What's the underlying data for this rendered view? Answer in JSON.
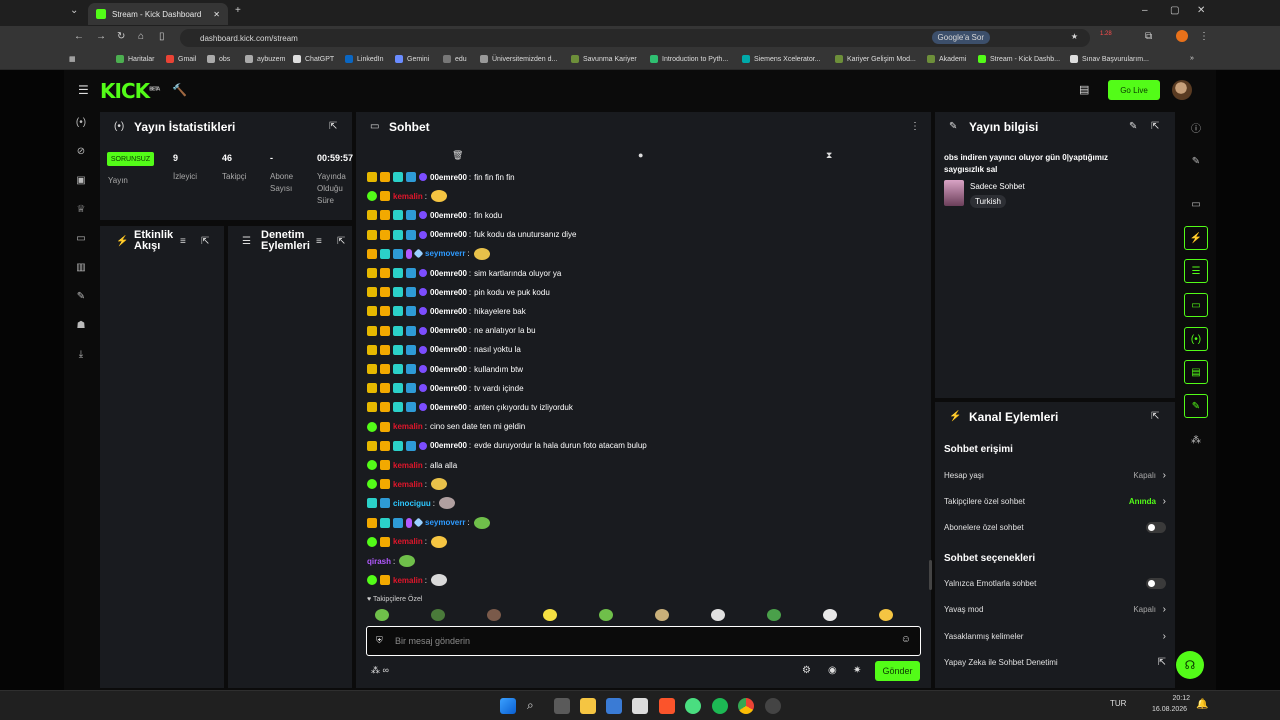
{
  "browser": {
    "tab_title": "Stream - Kick Dashboard",
    "url": "dashboard.kick.com/stream",
    "google_btn": "Google'a Sor",
    "ext_badge": "1.28",
    "bookmarks": [
      "Haritalar",
      "Gmail",
      "obs",
      "aybuzem",
      "ChatGPT",
      "LinkedIn",
      "Gemini",
      "edu",
      "Üniversitemizden d...",
      "Savunma Kariyer",
      "Introduction to Pyth...",
      "Siemens Xcelerator...",
      "Kariyer Gelişim Mod...",
      "Akademi",
      "Stream - Kick Dashb...",
      "Sınav Başvurularım..."
    ]
  },
  "header": {
    "logo": "KICK",
    "logo_sub": "BETA",
    "golive": "Go Live"
  },
  "stats": {
    "title": "Yayın İstatistikleri",
    "status_badge": "SORUNSUZ",
    "status_label": "Yayın",
    "viewers": "9",
    "viewers_label": "İzleyici",
    "followers": "46",
    "followers_label": "Takipçi",
    "subs": "-",
    "subs_label": "Abone Sayısı",
    "uptime": "00:59:57",
    "uptime_label": "Yayında Olduğu Süre"
  },
  "activity": {
    "title": "Etkinlik Akışı"
  },
  "moderation": {
    "title": "Denetim Eylemleri"
  },
  "chat": {
    "title": "Sohbet",
    "followers_only_note": "Takipçilere Özel",
    "input_placeholder": "Bir mesaj gönderin",
    "send": "Gönder",
    "messages": [
      {
        "user": "00emre00",
        "text": "fin fin fin fin"
      },
      {
        "user": "kemalin",
        "text": ""
      },
      {
        "user": "00emre00",
        "text": "fin kodu"
      },
      {
        "user": "00emre00",
        "text": "fuk kodu da unutursanız diye"
      },
      {
        "user": "seymoverr",
        "text": ""
      },
      {
        "user": "00emre00",
        "text": "sim kartlarında oluyor ya"
      },
      {
        "user": "00emre00",
        "text": "pin kodu ve puk kodu"
      },
      {
        "user": "00emre00",
        "text": "hikayelere bak"
      },
      {
        "user": "00emre00",
        "text": "ne anlatıyor la bu"
      },
      {
        "user": "00emre00",
        "text": "nasıl yoktu la"
      },
      {
        "user": "00emre00",
        "text": "kullandım btw"
      },
      {
        "user": "00emre00",
        "text": "tv vardı içinde"
      },
      {
        "user": "00emre00",
        "text": "anten çıkıyordu tv izliyorduk"
      },
      {
        "user": "kemalin",
        "text": "cino sen date ten mi geldin"
      },
      {
        "user": "00emre00",
        "text": "evde duruyordur la hala durun foto atacam bulup"
      },
      {
        "user": "kemalin",
        "text": "alla alla"
      },
      {
        "user": "kemalin",
        "text": ""
      },
      {
        "user": "cinociguu",
        "text": ""
      },
      {
        "user": "seymoverr",
        "text": ""
      },
      {
        "user": "kemalin",
        "text": ""
      },
      {
        "user": "qirash",
        "text": ""
      },
      {
        "user": "kemalin",
        "text": ""
      }
    ],
    "colors": {
      "00emre00": "#ffffff",
      "kemalin": "#e0162b",
      "seymoverr": "#2e9bff",
      "cinociguu": "#2ec8ff",
      "qirash": "#b259ff"
    }
  },
  "streaminfo": {
    "title": "Yayın bilgisi",
    "stream_title": "obs indiren yayıncı oluyor gün 0|yaptığımız saygısızlık sal",
    "category": "Sadece Sohbet",
    "language": "Turkish"
  },
  "channel": {
    "title": "Kanal Eylemleri",
    "access_h": "Sohbet erişimi",
    "account_age": "Hesap yaşı",
    "account_age_val": "Kapalı",
    "followers_only": "Takipçilere özel sohbet",
    "followers_only_val": "Anında",
    "subs_only": "Abonelere özel sohbet",
    "options_h": "Sohbet seçenekleri",
    "emote_only": "Yalnızca Emotlarla sohbet",
    "slow_mode": "Yavaş mod",
    "slow_mode_val": "Kapalı",
    "banned_words": "Yasaklanmış kelimeler",
    "ai_mod": "Yapay Zeka ile Sohbet Denetimi"
  },
  "taskbar": {
    "lang": "TUR",
    "time": "20:12",
    "date": "16.08.2026"
  }
}
